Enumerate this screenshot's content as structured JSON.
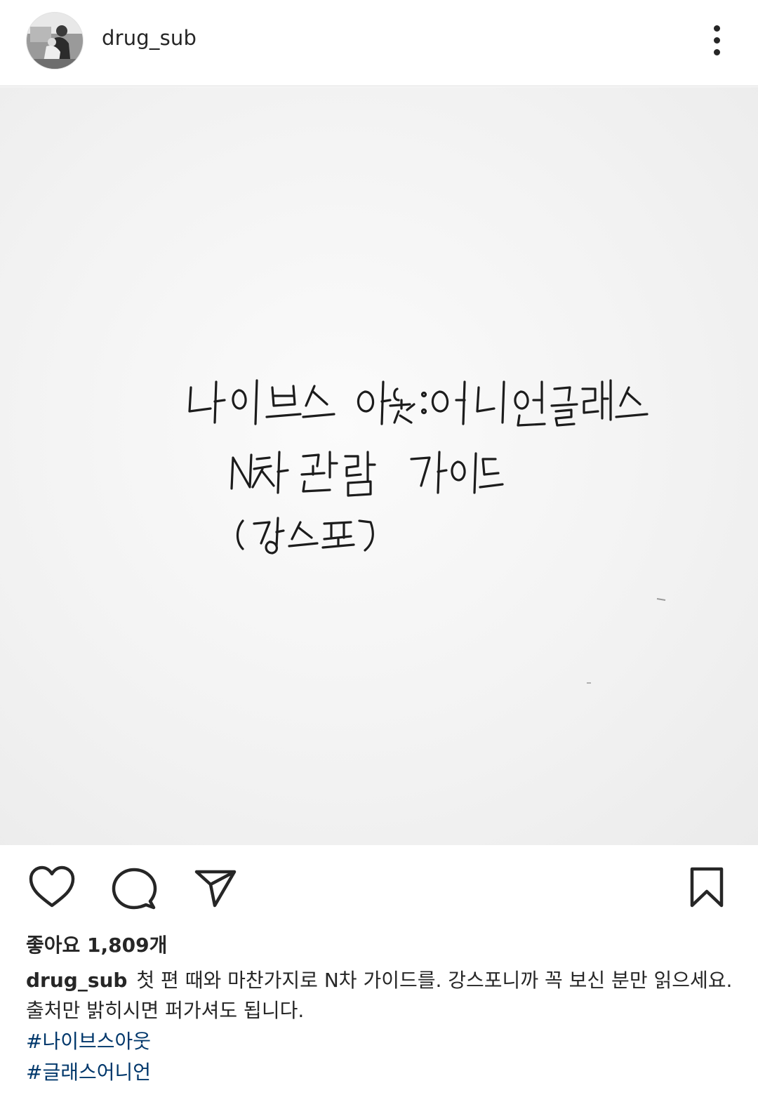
{
  "post": {
    "username": "drug_sub",
    "image_text_lines": [
      "나이브스 아웃 : 어니언 글래스",
      "N차 관람 가이드",
      "(강스포)"
    ],
    "likes_text": "좋아요 1,809개",
    "caption_username": "drug_sub",
    "caption_text": "첫 편 때와 마찬가지로 N차 가이드를. 강스포니까 꼭 보신 분만 읽으세요. 출처만 밝히시면 퍼가셔도 됩니다.",
    "hashtags": [
      "#나이브스아웃",
      "#글래스어니언"
    ]
  },
  "icons": {
    "avatar": "profile-photo",
    "more": "more-vertical-icon",
    "like": "heart-icon",
    "comment": "comment-icon",
    "share": "send-icon",
    "save": "bookmark-icon"
  },
  "colors": {
    "text": "#262626",
    "hashtag": "#00376b",
    "divider": "#dbdbdb"
  }
}
